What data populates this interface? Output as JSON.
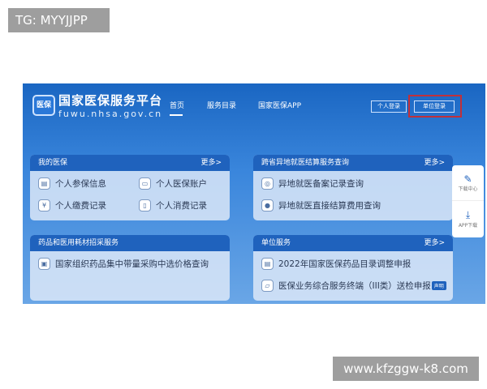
{
  "watermarks": {
    "top_left": "TG: MYYJJPP",
    "bottom_right": "www.kfzggw-k8.com"
  },
  "header": {
    "logo_text": "医保",
    "title": "国家医保服务平台",
    "url": "fuwu.nhsa.gov.cn",
    "nav": [
      {
        "label": "首页",
        "active": true
      },
      {
        "label": "服务目录"
      },
      {
        "label": "国家医保APP"
      }
    ],
    "personal_login": "个人登录",
    "unit_login": "单位登录"
  },
  "cards": [
    {
      "title": "我的医保",
      "more": "更多>",
      "items": [
        "个人参保信息",
        "个人医保账户",
        "个人缴费记录",
        "个人消费记录"
      ]
    },
    {
      "title": "跨省异地就医结算服务查询",
      "more": "更多>",
      "items": [
        "异地就医备案记录查询",
        "异地就医直接结算费用查询"
      ]
    },
    {
      "title": "药品和医用耗材招采服务",
      "items": [
        "国家组织药品集中带量采购中选价格查询"
      ]
    },
    {
      "title": "单位服务",
      "more": "更多>",
      "items": [
        "2022年国家医保药品目录调整申报",
        "医保业务综合服务终端（III类）送检申报"
      ],
      "badge": "声明"
    }
  ],
  "side": {
    "download_center": "下载中心",
    "app_download": "APP下载"
  },
  "colors": {
    "header_blue": "#1a66c2",
    "card_header": "#1f62bd",
    "highlight": "#c0303a"
  }
}
